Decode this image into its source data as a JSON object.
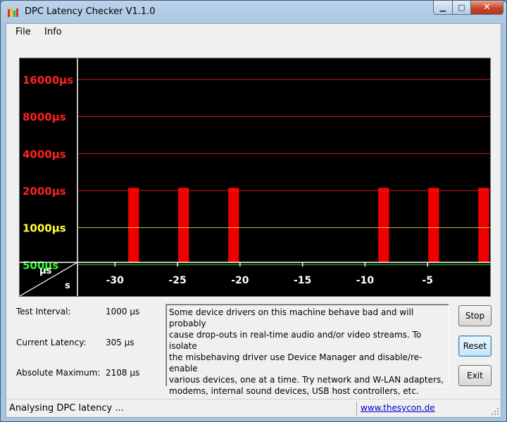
{
  "window": {
    "title": "DPC Latency Checker V1.1.0",
    "controls": {
      "minimize": "▁",
      "maximize": "□",
      "close": "✕"
    }
  },
  "menu": {
    "items": [
      "File",
      "Info"
    ]
  },
  "chart_data": {
    "type": "bar",
    "scale": "log",
    "unit_label": "µs",
    "x_unit_label": "s",
    "y_ticks": [
      {
        "label": "16000µs",
        "value": 16000,
        "color": "#ff2020"
      },
      {
        "label": "8000µs",
        "value": 8000,
        "color": "#ff2020"
      },
      {
        "label": "4000µs",
        "value": 4000,
        "color": "#ff2020"
      },
      {
        "label": "2000µs",
        "value": 2000,
        "color": "#ff2020"
      },
      {
        "label": "1000µs",
        "value": 1000,
        "color": "#ffff30"
      },
      {
        "label": "500µs",
        "value": 500,
        "color": "#30ff30"
      }
    ],
    "x_ticks": [
      "-30",
      "-25",
      "-20",
      "-15",
      "-10",
      "-5"
    ],
    "x_tick_values": [
      -30,
      -25,
      -20,
      -15,
      -10,
      -5
    ],
    "x_range": [
      -33,
      0
    ],
    "grid": true,
    "values": [
      305,
      300,
      295,
      310,
      2108,
      320,
      315,
      300,
      2108,
      305,
      300,
      305,
      2108,
      295,
      295,
      310,
      300,
      300,
      305,
      330,
      340,
      330,
      300,
      345,
      2108,
      300,
      305,
      305,
      2108,
      500,
      305,
      310,
      2108
    ],
    "colors": {
      "normal": "#00ee00",
      "alarm": "#ee0000"
    }
  },
  "info": {
    "test_interval": {
      "label": "Test Interval:",
      "value": "1000 µs"
    },
    "current_latency": {
      "label": "Current Latency:",
      "value": "305 µs"
    },
    "absolute_maximum": {
      "label": "Absolute Maximum:",
      "value": "2108 µs"
    }
  },
  "message": {
    "lines": [
      "Some device drivers on this machine behave bad and will probably",
      "cause drop-outs in real-time audio and/or video streams. To isolate",
      "the misbehaving driver use Device Manager and disable/re-enable",
      "various devices, one at a time. Try network and W-LAN adapters,",
      "modems, internal sound devices, USB host controllers, etc."
    ]
  },
  "buttons": {
    "stop": "Stop",
    "reset": "Reset",
    "exit": "Exit"
  },
  "status": {
    "text": "Analysing DPC latency ...",
    "link": "www.thesycon.de"
  }
}
